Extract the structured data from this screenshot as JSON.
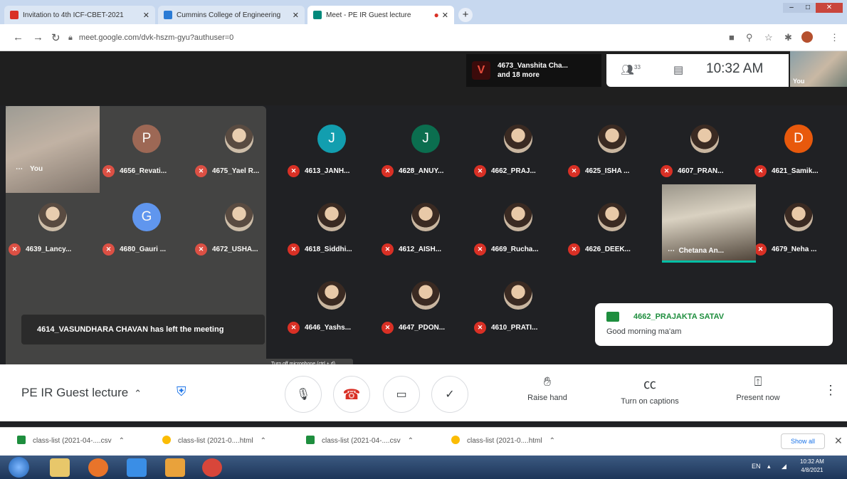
{
  "browser": {
    "tabs": [
      {
        "title": "Invitation to 4th ICF-CBET-2021",
        "icon": "gmail-icon",
        "color": "#d93025"
      },
      {
        "title": "Cummins College of Engineering",
        "icon": "site-icon",
        "color": "#2a7bd5"
      },
      {
        "title": "Meet - PE IR Guest lecture",
        "icon": "meet-icon",
        "color": "#00897b"
      }
    ],
    "url": "meet.google.com/dvk-hszm-gyu?authuser=0",
    "new_tab": "+"
  },
  "meeting": {
    "presenter_line1": "4673_Vanshita Cha...",
    "presenter_line2": "and 18 more",
    "people_count": "33",
    "time": "10:32 AM",
    "self_thumb_label": "You",
    "self_tile_label": "You",
    "tiles_row1": [
      {
        "initial": "P",
        "name": "4656_Revati...",
        "color": "#8d4e3a"
      },
      {
        "initial": "",
        "name": "4675_Yael R...",
        "color": "#7a6a5a"
      },
      {
        "initial": "J",
        "name": "4613_JANH...",
        "color": "#129eaf"
      },
      {
        "initial": "J",
        "name": "4628_ANUY...",
        "color": "#0b6e4f"
      },
      {
        "initial": "",
        "name": "4662_PRAJ...",
        "color": "#7a6a5a"
      },
      {
        "initial": "",
        "name": "4625_ISHA ...",
        "color": "#7a6a5a"
      },
      {
        "initial": "",
        "name": "4607_PRAN...",
        "color": "#7a6a5a"
      },
      {
        "initial": "D",
        "name": "4621_Samik...",
        "color": "#e8590c"
      }
    ],
    "tiles_row2": [
      {
        "initial": "",
        "name": "4639_Lancy...",
        "color": "#7a6a5a"
      },
      {
        "initial": "G",
        "name": "4680_Gauri ...",
        "color": "#4285f4"
      },
      {
        "initial": "",
        "name": "4672_USHA...",
        "color": "#7a6a5a"
      },
      {
        "initial": "",
        "name": "4618_Siddhi...",
        "color": "#7a6a5a"
      },
      {
        "initial": "",
        "name": "4612_AISH...",
        "color": "#5b4fd6"
      },
      {
        "initial": "",
        "name": "4669_Rucha...",
        "color": "#7a6a5a"
      },
      {
        "initial": "",
        "name": "4626_DEEK...",
        "color": "#7a6a5a"
      },
      {
        "initial": "",
        "name": "4679_Neha ...",
        "color": "#a142f4"
      }
    ],
    "tiles_row3": [
      {
        "initial": "",
        "name": "4646_Yashs...",
        "color": "#7a6a5a"
      },
      {
        "initial": "",
        "name": "4647_PDON...",
        "color": "#7a6a5a"
      },
      {
        "initial": "",
        "name": "4610_PRATI...",
        "color": "#7a6a5a"
      }
    ],
    "video_tile_name": "Chetana An...",
    "toast": "4614_VASUNDHARA CHAVAN has left the meeting",
    "tooltip": "Turn off microphone (ctrl + d)",
    "chat_sender": "4662_PRAJAKTA SATAV",
    "chat_message": "Good morning ma'am"
  },
  "controls": {
    "meeting_name": "PE IR Guest lecture",
    "raise_hand": "Raise hand",
    "captions": "Turn on captions",
    "present": "Present now"
  },
  "downloads": {
    "items": [
      {
        "name": "class-list (2021-04-....csv",
        "icon": "csv-file-icon",
        "color": "#1e8e3e"
      },
      {
        "name": "class-list (2021-0....html",
        "icon": "chrome-file-icon",
        "color": "#fbbc04"
      },
      {
        "name": "class-list (2021-04-....csv",
        "icon": "csv-file-icon",
        "color": "#1e8e3e"
      },
      {
        "name": "class-list (2021-0....html",
        "icon": "chrome-file-icon",
        "color": "#fbbc04"
      }
    ],
    "show_all": "Show all"
  },
  "taskbar": {
    "lang": "EN",
    "clock_time": "10:32 AM",
    "clock_date": "4/8/2021"
  }
}
